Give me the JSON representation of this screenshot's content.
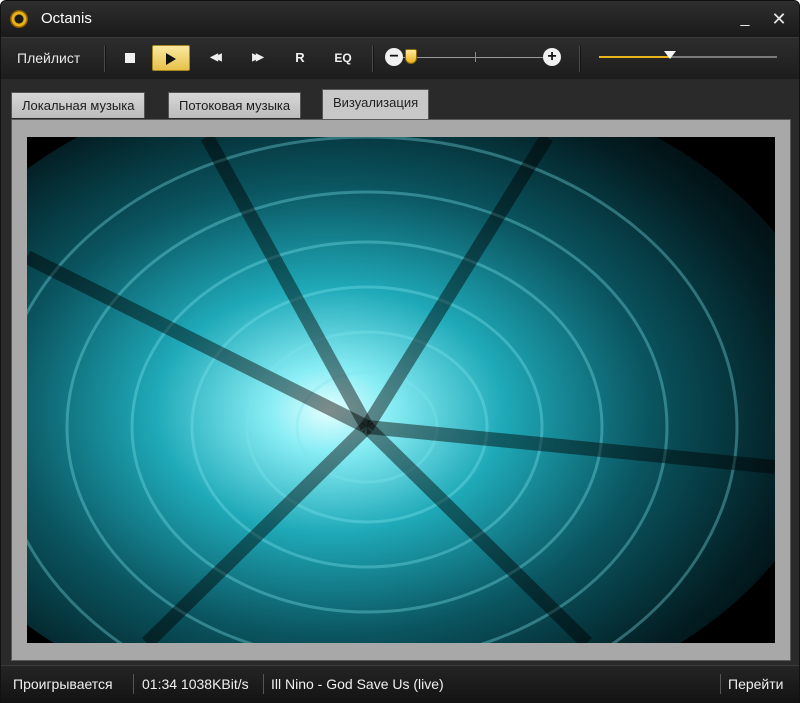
{
  "window": {
    "title": "Octanis",
    "minimize_glyph": "_",
    "close_glyph": "✕"
  },
  "toolbar": {
    "playlist_label": "Плейлист",
    "prev_glyph": "◀◀",
    "next_glyph": "▶▶",
    "repeat_label": "R",
    "eq_label": "EQ",
    "volume_minus": "−",
    "volume_plus": "+",
    "volume_level": 0.05,
    "position_progress": 0.4
  },
  "tabs": [
    {
      "label": "Локальная музыка"
    },
    {
      "label": "Потоковая музыка"
    },
    {
      "label": "Визуализация",
      "active": true
    }
  ],
  "status": {
    "state": "Проигрывается",
    "time_bitrate": "01:34 1038KBit/s",
    "track": "Ill Nino - God Save Us (live)",
    "goto": "Перейти"
  },
  "colors": {
    "accent": "#e8b41a",
    "visual": "#32c8d8"
  }
}
